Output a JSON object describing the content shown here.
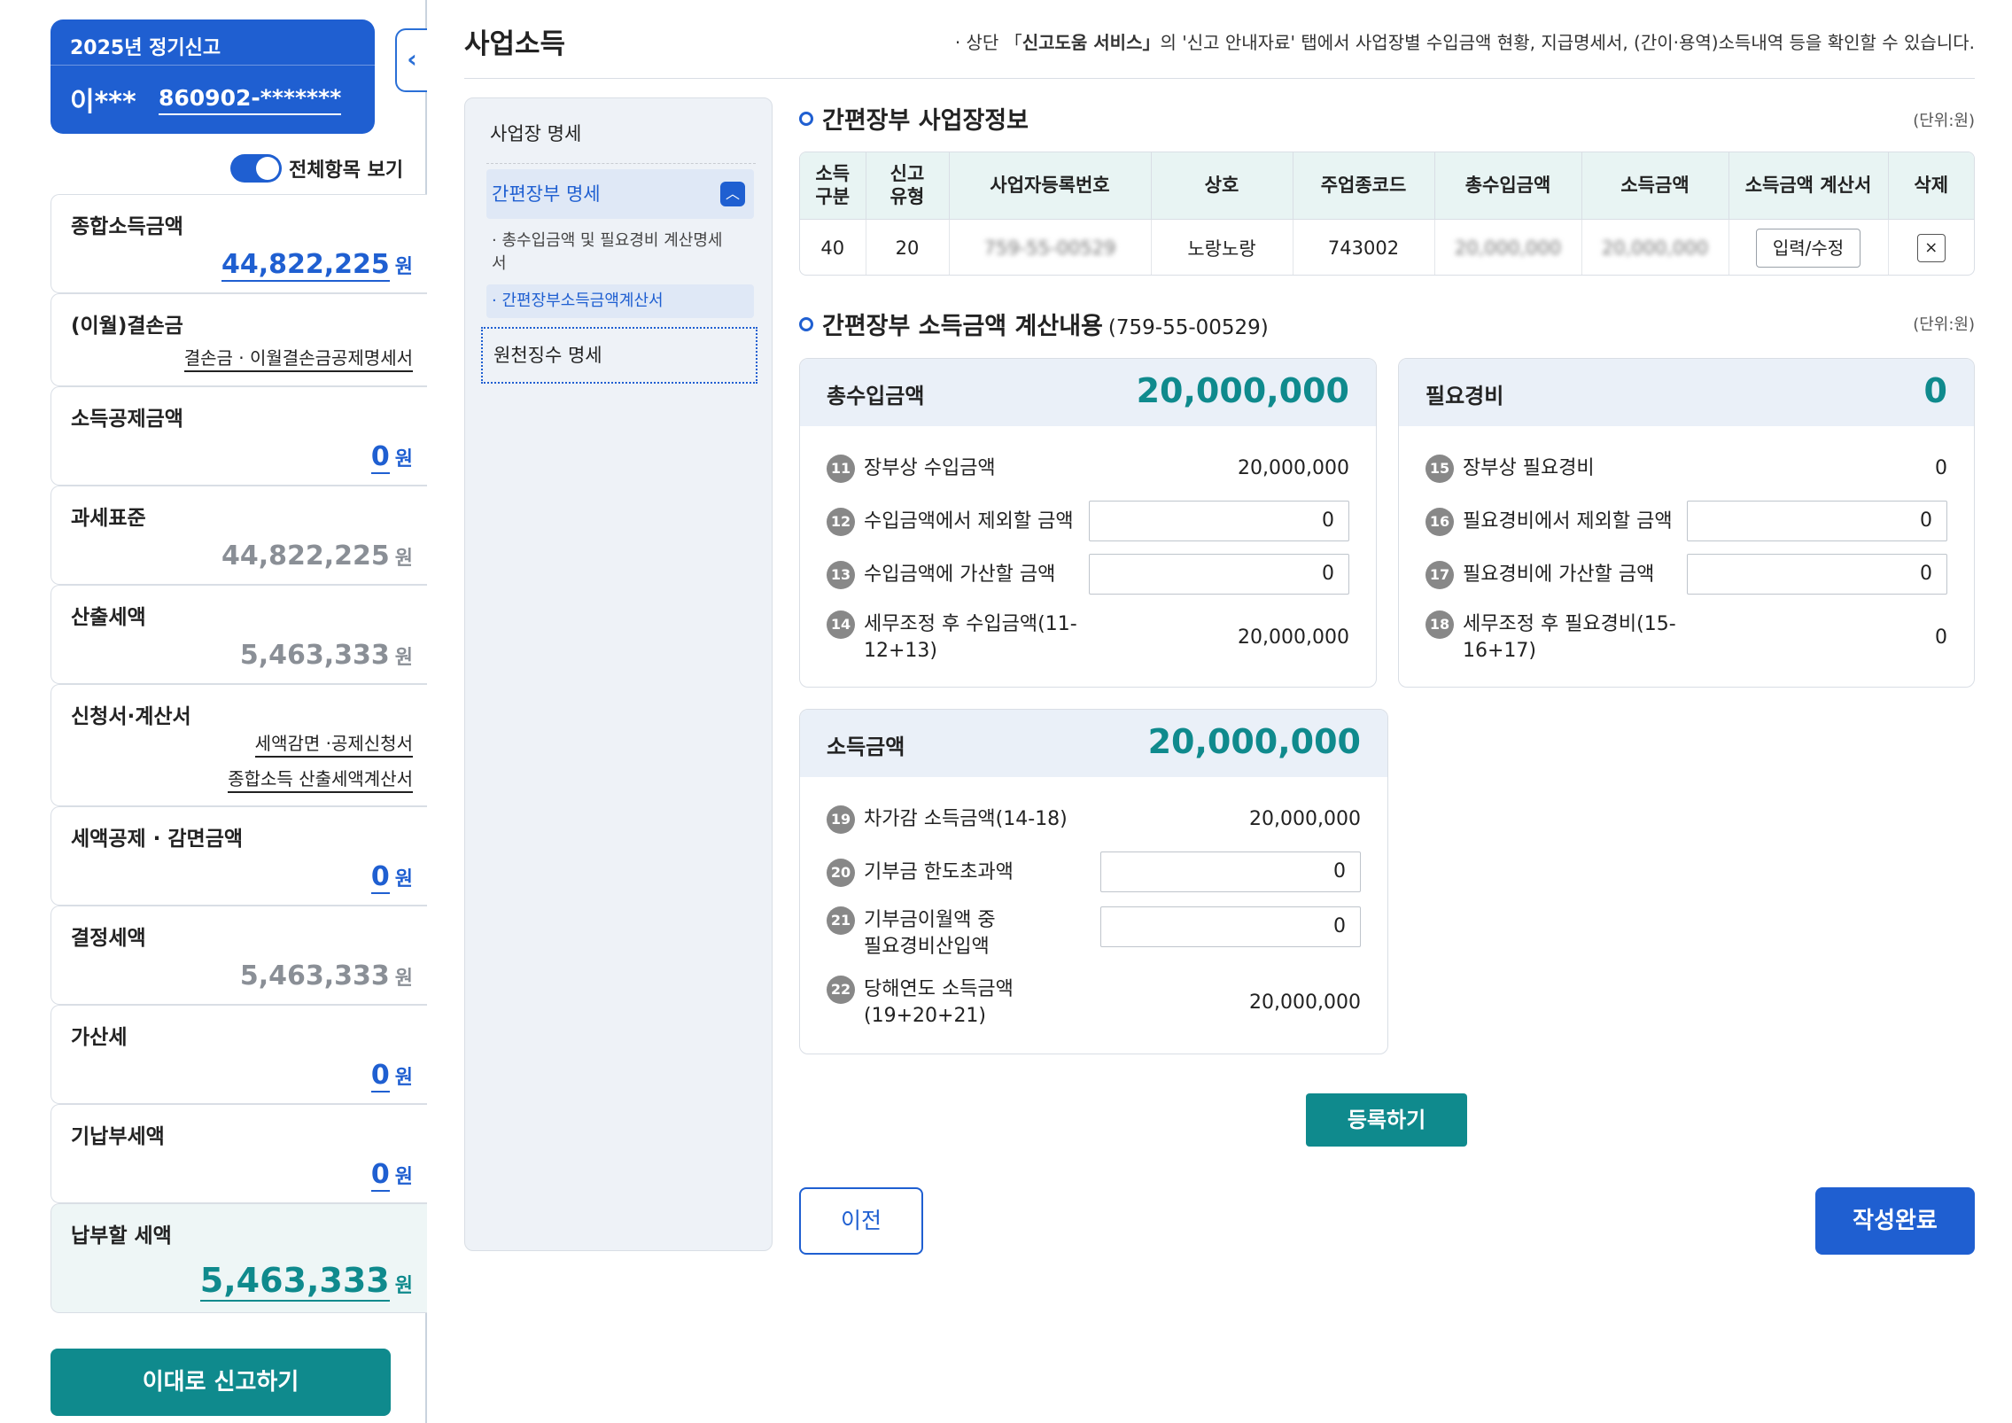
{
  "user": {
    "year_label": "2025년 정기신고",
    "name": "이***",
    "rrn": "860902-*******"
  },
  "toggle": {
    "label": "전체항목 보기"
  },
  "summary": {
    "total_income": {
      "label": "종합소득금액",
      "value": "44,822,225",
      "unit": "원"
    },
    "loss": {
      "label": "(이월)결손금",
      "link": "결손금 · 이월결손금공제명세서"
    },
    "deduction": {
      "label": "소득공제금액",
      "value": "0",
      "unit": "원"
    },
    "tax_base": {
      "label": "과세표준",
      "value": "44,822,225",
      "unit": "원"
    },
    "calc_tax": {
      "label": "산출세액",
      "value": "5,463,333",
      "unit": "원"
    },
    "forms": {
      "label": "신청서·계산서",
      "link1": "세액감면 ·공제신청서",
      "link2": "종합소득 산출세액계산서"
    },
    "credit": {
      "label": "세액공제 · 감면금액",
      "value": "0",
      "unit": "원"
    },
    "decided_tax": {
      "label": "결정세액",
      "value": "5,463,333",
      "unit": "원"
    },
    "penalty": {
      "label": "가산세",
      "value": "0",
      "unit": "원"
    },
    "prepaid": {
      "label": "기납부세액",
      "value": "0",
      "unit": "원"
    },
    "payable": {
      "label": "납부할 세액",
      "value": "5,463,333",
      "unit": "원"
    }
  },
  "file_button": "이대로 신고하기",
  "header": {
    "title": "사업소득",
    "notice_pre": "상단 「",
    "notice_bold": "신고도움 서비스」",
    "notice_post": "의 '신고 안내자료' 탭에서 사업장별 수입금액 현황, 지급명세서, (간이·용역)소득내역 등을 확인할 수 있습니다."
  },
  "nav": {
    "item1": "사업장 명세",
    "item2": "간편장부 명세",
    "sub1": "총수입금액 및 필요경비 계산명세서",
    "sub2": "간편장부소득금액계산서",
    "item3": "원천징수 명세"
  },
  "section1": {
    "title": "간편장부 사업장정보",
    "unit": "(단위:원)"
  },
  "table": {
    "headers": [
      "소득구분",
      "신고유형",
      "사업자등록번호",
      "상호",
      "주업종코드",
      "총수입금액",
      "소득금액",
      "소득금액 계산서",
      "삭제"
    ],
    "row": {
      "income_type": "40",
      "report_type": "20",
      "reg_no": "759-55-00529",
      "name": "노랑노랑",
      "code": "743002",
      "revenue": "20,000,000",
      "income": "20,000,000",
      "edit": "입력/수정",
      "delete": "×"
    }
  },
  "section2": {
    "title": "간편장부 소득금액 계산내용",
    "reg": "(759-55-00529)",
    "unit": "(단위:원)"
  },
  "revenue_card": {
    "title": "총수입금액",
    "total": "20,000,000",
    "rows": [
      {
        "no": "11",
        "label": "장부상 수입금액",
        "value": "20,000,000"
      },
      {
        "no": "12",
        "label": "수입금액에서 제외할 금액",
        "value": "0"
      },
      {
        "no": "13",
        "label": "수입금액에 가산할 금액",
        "value": "0"
      },
      {
        "no": "14",
        "label1": "세무조정 후 수입금액(11-",
        "label2": "12+13)",
        "value": "20,000,000"
      }
    ]
  },
  "expense_card": {
    "title": "필요경비",
    "total": "0",
    "rows": [
      {
        "no": "15",
        "label": "장부상 필요경비",
        "value": "0"
      },
      {
        "no": "16",
        "label": "필요경비에서 제외할 금액",
        "value": "0"
      },
      {
        "no": "17",
        "label": "필요경비에 가산할 금액",
        "value": "0"
      },
      {
        "no": "18",
        "label1": "세무조정 후 필요경비(15-",
        "label2": "16+17)",
        "value": "0"
      }
    ]
  },
  "income_card": {
    "title": "소득금액",
    "total": "20,000,000",
    "rows": [
      {
        "no": "19",
        "label": "차가감 소득금액(14-18)",
        "value": "20,000,000"
      },
      {
        "no": "20",
        "label": "기부금 한도초과액",
        "value": "0"
      },
      {
        "no": "21",
        "label1": "기부금이월액 중",
        "label2": "필요경비산입액",
        "value": "0"
      },
      {
        "no": "22",
        "label1": "당해연도 소득금액",
        "label2": "(19+20+21)",
        "value": "20,000,000"
      }
    ]
  },
  "buttons": {
    "register": "등록하기",
    "prev": "이전",
    "done": "작성완료"
  }
}
